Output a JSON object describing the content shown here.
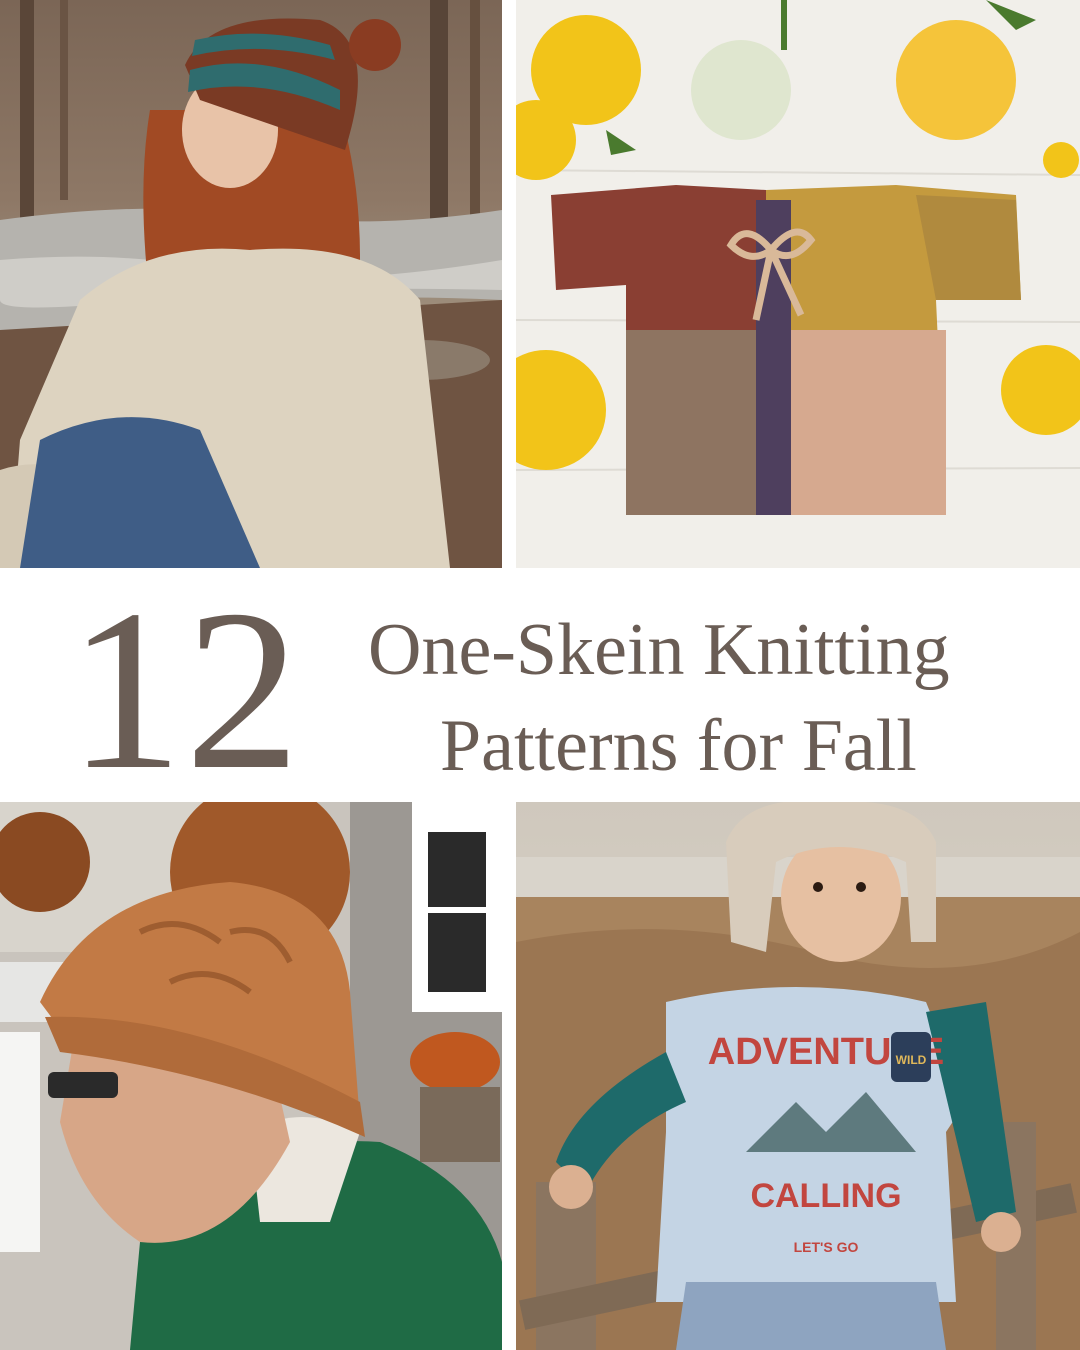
{
  "title": {
    "number": "12",
    "line1": "One-Skein Knitting",
    "line2": "Patterns for Fall"
  },
  "photos": {
    "top_left": "woman in striped slouchy pom-pom hat and cream cable sweater by a river",
    "top_right": "colorblock baby cardigan with tie among yellow flowers",
    "bottom_left": "man in tan cabled beanie and green hoodie",
    "bottom_right": "child in trapper hat with teal arm warmers"
  },
  "tshirt_print": {
    "top": "ADVENTURE",
    "badge": "WILD",
    "middle": "CALLING",
    "small": "LET'S GO"
  },
  "colors": {
    "title_text": "#6a5d55",
    "background": "#ffffff"
  }
}
